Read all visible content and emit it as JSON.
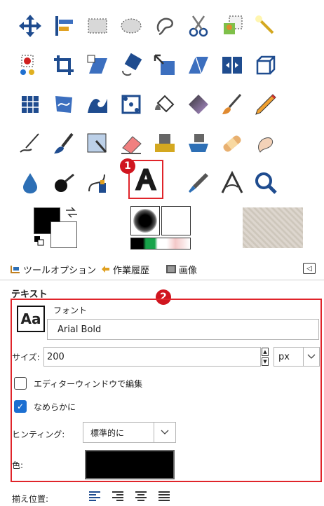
{
  "toolbox": {
    "tools": [
      "move-tool",
      "align-tool",
      "rect-select-tool",
      "ellipse-select-tool",
      "free-select-tool",
      "scissors-select-tool",
      "foreground-select-tool",
      "fuzzy-select-tool",
      "color-select-tool",
      "crop-tool",
      "unified-transform-tool",
      "rotate-tool",
      "scale-tool",
      "shear-tool",
      "flip-tool",
      "3d-transform-tool",
      "cage-transform-tool",
      "warp-transform-tool",
      "wave-tool",
      "handle-transform-tool",
      "bucket-fill-tool",
      "gradient-tool",
      "paintbrush-tool",
      "pencil-tool",
      "ink-tool",
      "mypaint-brush-tool",
      "smudge-paint-tool",
      "eraser-tool",
      "clone-tool",
      "perspective-clone-tool",
      "heal-tool",
      "smudge-tool",
      "blur-tool",
      "dodge-burn-tool",
      "paths-tool",
      "text-tool",
      "color-picker-tool",
      "measure-tool",
      "measure-angle-tool",
      "zoom-tool"
    ],
    "marker1": "1",
    "marker2": "2"
  },
  "colors": {
    "foreground": "#000000",
    "background": "#ffffff",
    "accent": "#e0242a"
  },
  "tabs": {
    "tool_options": "ツールオプション",
    "undo_history": "作業履歴",
    "images": "画像"
  },
  "section_title": "テキスト",
  "text_options": {
    "font_preview": "Aa",
    "font_label": "フォント",
    "font_value": "Arial Bold",
    "size_label": "サイズ:",
    "size_value": "200",
    "unit_value": "px",
    "use_editor_label": "エディターウィンドウで編集",
    "use_editor_checked": false,
    "antialias_label": "なめらかに",
    "antialias_checked": true,
    "hinting_label": "ヒンティング:",
    "hinting_value": "標準的に",
    "color_label": "色:",
    "color_value": "#000000",
    "justify_label": "揃え位置:"
  }
}
